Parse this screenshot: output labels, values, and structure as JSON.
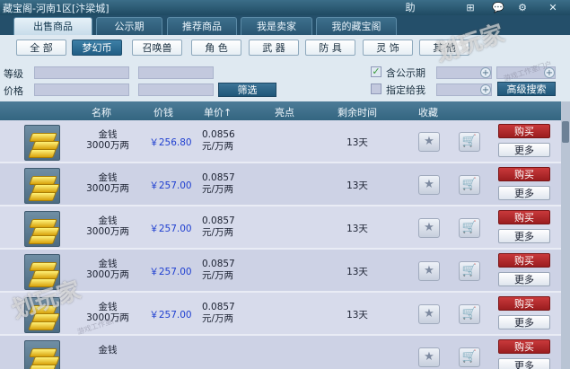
{
  "window": {
    "title": "藏宝阁-河南1区[汴梁城]",
    "controls": [
      "助",
      "⊞",
      "💬",
      "⚙",
      "✕"
    ]
  },
  "tabs": [
    "出售商品",
    "公示期",
    "推荐商品",
    "我是卖家",
    "我的藏宝阁"
  ],
  "categories": [
    "全 部",
    "梦幻币",
    "召唤兽",
    "角 色",
    "武 器",
    "防 具",
    "灵 饰",
    "其 他"
  ],
  "active_category": "梦幻币",
  "filter": {
    "level_label": "等级",
    "price_label": "价格",
    "filter_button": "筛选",
    "include_public_label": "含公示期",
    "include_public_checked": true,
    "designated_label": "指定给我",
    "designated_checked": false,
    "advanced_button": "高级搜索"
  },
  "table": {
    "columns": [
      "名称",
      "价钱",
      "单价↑",
      "亮点",
      "剩余时间",
      "收藏"
    ],
    "buy_label": "购买",
    "more_label": "更多",
    "rows": [
      {
        "name": "金钱",
        "amount": "3000万两",
        "price": "￥256.80",
        "unit_value": "0.0856",
        "unit_label": "元/万两",
        "time": "13天"
      },
      {
        "name": "金钱",
        "amount": "3000万两",
        "price": "￥257.00",
        "unit_value": "0.0857",
        "unit_label": "元/万两",
        "time": "13天"
      },
      {
        "name": "金钱",
        "amount": "3000万两",
        "price": "￥257.00",
        "unit_value": "0.0857",
        "unit_label": "元/万两",
        "time": "13天"
      },
      {
        "name": "金钱",
        "amount": "3000万两",
        "price": "￥257.00",
        "unit_value": "0.0857",
        "unit_label": "元/万两",
        "time": "13天"
      },
      {
        "name": "金钱",
        "amount": "3000万两",
        "price": "￥257.00",
        "unit_value": "0.0857",
        "unit_label": "元/万两",
        "time": "13天"
      },
      {
        "name": "金钱",
        "amount": "",
        "price": "",
        "unit_value": "",
        "unit_label": "",
        "time": ""
      }
    ]
  },
  "watermark": {
    "main": "划玩家",
    "sub": "游戏工作室门户"
  },
  "icons": {
    "star": "star-icon",
    "cart": "cart-icon",
    "check": "check-icon",
    "plus": "plus-icon"
  }
}
